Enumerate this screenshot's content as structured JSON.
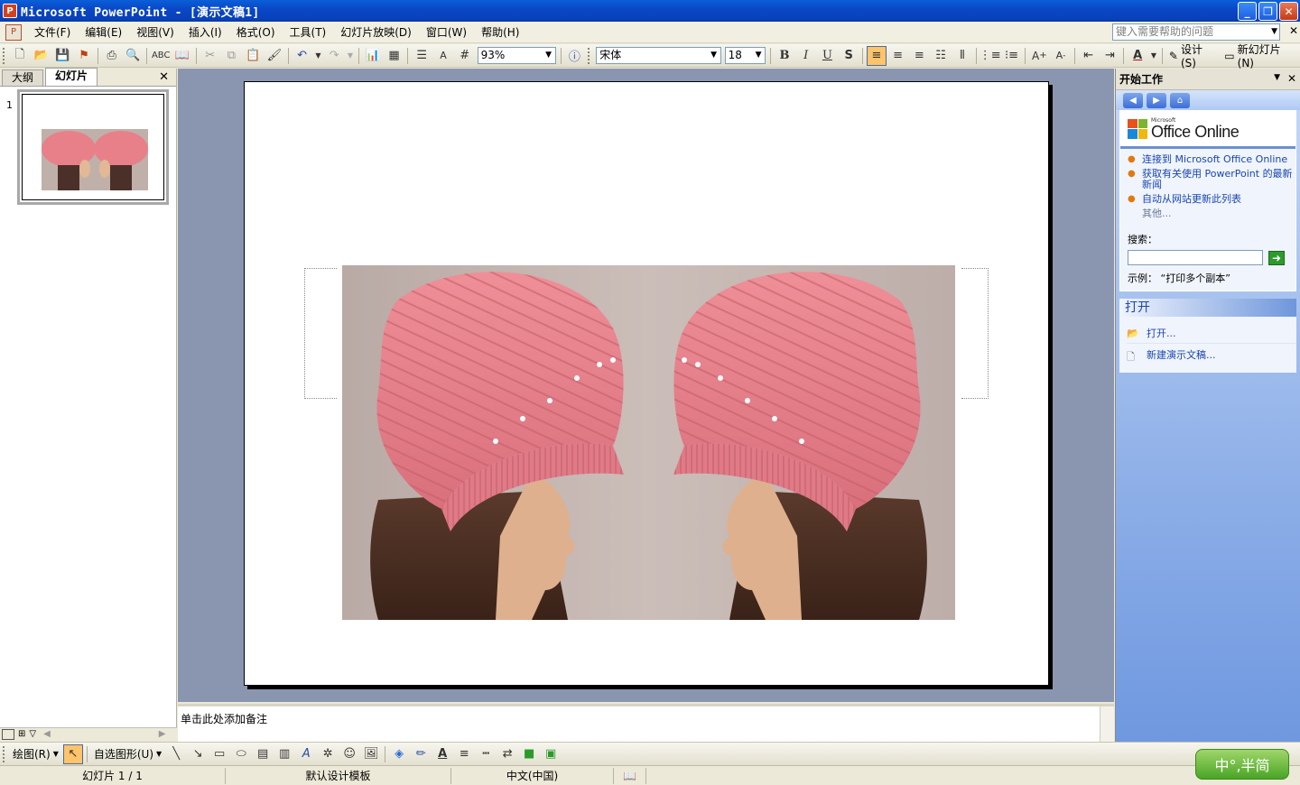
{
  "window": {
    "app_icon": "P",
    "title": "Microsoft PowerPoint - [演示文稿1]",
    "minimize_icon": "_",
    "maximize_icon": "❐",
    "close_icon": "✕"
  },
  "menu": {
    "doc_icon": "P",
    "items": [
      "文件(F)",
      "编辑(E)",
      "视图(V)",
      "插入(I)",
      "格式(O)",
      "工具(T)",
      "幻灯片放映(D)",
      "窗口(W)",
      "帮助(H)"
    ],
    "help_placeholder": "键入需要帮助的问题",
    "close_icon": "✕"
  },
  "toolbar": {
    "zoom": "93%",
    "font_name": "宋体",
    "font_size": "18",
    "bold": "B",
    "italic": "I",
    "underline": "U",
    "shadow": "S",
    "design_label": "设计(S)",
    "new_slide_label": "新幻灯片(N)"
  },
  "left_pane": {
    "tabs": [
      "大纲",
      "幻灯片"
    ],
    "close_icon": "✕",
    "slide_number": "1"
  },
  "notes": {
    "placeholder": "单击此处添加备注"
  },
  "task_pane": {
    "title": "开始工作",
    "logo_small": "Microsoft",
    "logo_big": "Office Online",
    "links": [
      "连接到 Microsoft Office Online",
      "获取有关使用 PowerPoint 的最新新闻",
      "自动从网站更新此列表"
    ],
    "more": "其他...",
    "search_label": "搜索：",
    "example": "示例：  “打印多个副本”",
    "open_section": "打开",
    "open_items": [
      "打开...",
      "新建演示文稿..."
    ]
  },
  "drawing_toolbar": {
    "draw_label": "绘图(R)",
    "autoshapes_label": "自选图形(U)"
  },
  "status": {
    "slide": "幻灯片 1 / 1",
    "template": "默认设计模板",
    "language": "中文(中国)"
  },
  "ime": {
    "label": "中°,半简"
  },
  "colors": {
    "titlebar": "#0a48c8",
    "slide_bg": "#8a96b0",
    "hat": "#e8828a",
    "taskpane": "#8fb0e8"
  }
}
